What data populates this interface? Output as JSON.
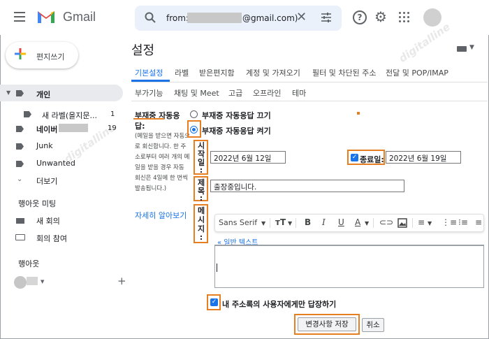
{
  "topbar": {
    "app_name": "Gmail",
    "search_prefix": "from:",
    "search_suffix": "@gmail.com)",
    "clear_glyph": "✕",
    "help_glyph": "?",
    "gear_glyph": "⚙"
  },
  "watermark": "digitalline",
  "sidebar": {
    "compose_label": "편지쓰기",
    "items": [
      {
        "label": "개인",
        "count": ""
      },
      {
        "label": "새 라벨(을지문...",
        "count": "1"
      },
      {
        "label": "네이버",
        "count": "19"
      },
      {
        "label": "Junk",
        "count": ""
      },
      {
        "label": "Unwanted",
        "count": ""
      },
      {
        "label": "더보기",
        "count": ""
      }
    ],
    "meet_title": "행아웃 미팅",
    "meet_new": "새 회의",
    "meet_join": "회의 참여",
    "hangouts_title": "행아웃",
    "plus_glyph": "+"
  },
  "settings": {
    "title": "설정",
    "tabs": [
      "기본설정",
      "라벨",
      "받은편지함",
      "계정 및 가져오기",
      "필터 및 차단된 주소",
      "전달 및 POP/IMAP"
    ],
    "subtabs": [
      "부가기능",
      "채팅 및 Meet",
      "고급",
      "오프라인",
      "테마"
    ],
    "vacation": {
      "label_line1": "부재중 자동응",
      "label_line2": "답:",
      "description": "(메일을 받으면 자동으로 회신합니다. 한 주소로부터 여러 개의 메일을 받을 경우 자동 회신은 4일에 한 번씩 발송됩니다.)",
      "learn_more": "자세히 알아보기",
      "off_label": "부재중 자동응답 끄기",
      "on_label": "부재중 자동응답 켜기",
      "start_label": [
        "시",
        "작",
        "일",
        ":"
      ],
      "start_value": "2022년 6월 12일",
      "end_label": "종료일:",
      "end_value": "2022년 6월 19일",
      "subject_label": [
        "제",
        "목",
        ":"
      ],
      "subject_value": "출장중입니다.",
      "message_label": [
        "메",
        "시",
        "지",
        ":"
      ],
      "font_name": "Sans Serif",
      "plain_text_link": "« 일반 텍스트",
      "contacts_only": "내 주소록의 사용자에게만 답장하기",
      "save_button": "변경사항 저장",
      "cancel_button": "취소"
    }
  },
  "colors": {
    "accent": "#1a73e8",
    "highlight": "#e67e22"
  }
}
